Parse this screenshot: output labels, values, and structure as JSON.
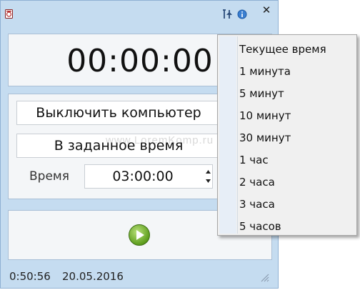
{
  "window": {
    "close_label": "✕"
  },
  "timer": {
    "display": "00:00:00"
  },
  "actions": {
    "action_field": "Выключить компьютер",
    "mode_field": "В заданное время",
    "time_label": "Время",
    "time_value": "03:00:00"
  },
  "status": {
    "clock": "0:50:56",
    "date": "20.05.2016"
  },
  "menu": {
    "items": [
      "Текущее время",
      "1 минута",
      "5 минут",
      "10 минут",
      "30 минут",
      "1 час",
      "2 часа",
      "3 часа",
      "5 часов"
    ]
  },
  "watermark": "www.LoremKomp.ru",
  "colors": {
    "window": "#c5dcf0",
    "panel": "#f4f6f8",
    "play": "#5e9e1d",
    "menu": "#f0f0f0"
  },
  "icons": [
    "app-icon",
    "tools-icon",
    "info-icon",
    "close-icon",
    "play-icon",
    "spin-up-icon",
    "spin-down-icon",
    "resize-grip-icon"
  ]
}
